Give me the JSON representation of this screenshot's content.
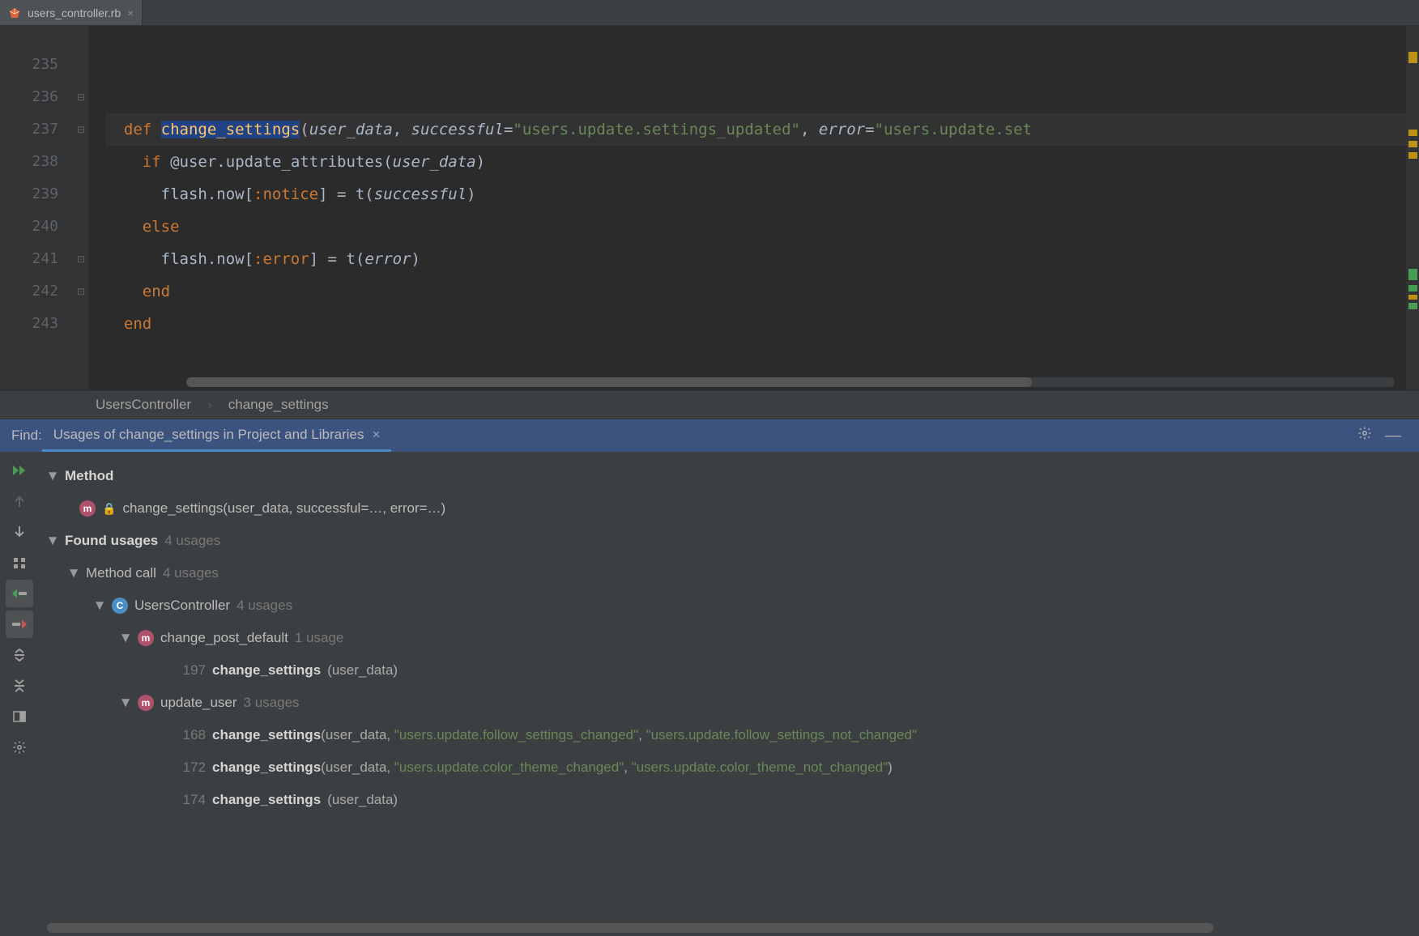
{
  "tab": {
    "filename": "users_controller.rb"
  },
  "editor": {
    "lines": [
      "235",
      "236",
      "237",
      "238",
      "239",
      "240",
      "241",
      "242",
      "243"
    ],
    "code": {
      "l236": {
        "def": "def ",
        "name": "change_settings",
        "open": "(",
        "p1": "user_data",
        "c1": ", ",
        "p2": "successful",
        "eq1": "=",
        "s1": "\"users.update.settings_updated\"",
        "c2": ", ",
        "p3": "error",
        "eq2": "=",
        "s2": "\"users.update.set"
      },
      "l237": {
        "if": "if ",
        "ivar": "@user",
        "dot": ".",
        "m": "update_attributes",
        "open": "(",
        "p": "user_data",
        "close": ")"
      },
      "l238": {
        "pre": "flash.now[",
        "sym": ":notice",
        "post": "] = t(",
        "p": "successful",
        "close": ")"
      },
      "l239": {
        "else": "else"
      },
      "l240": {
        "pre": "flash.now[",
        "sym": ":error",
        "post": "] = t(",
        "p": "error",
        "close": ")"
      },
      "l241": {
        "end": "end"
      },
      "l242": {
        "end": "end"
      }
    }
  },
  "breadcrumb": {
    "class": "UsersController",
    "method": "change_settings"
  },
  "find": {
    "label": "Find:",
    "title": "Usages of change_settings in Project and Libraries"
  },
  "tree": {
    "method_header": "Method",
    "method_sig": "change_settings(user_data, successful=…, error=…)",
    "found": "Found usages",
    "found_count": "4 usages",
    "method_call": "Method call",
    "method_call_count": "4 usages",
    "controller": "UsersController",
    "controller_count": "4 usages",
    "cpd": "change_post_default",
    "cpd_count": "1 usage",
    "uu": "update_user",
    "uu_count": "3 usages",
    "r1": {
      "ln": "197",
      "call": "change_settings",
      "args": "(user_data)"
    },
    "r2": {
      "ln": "168",
      "call": "change_settings",
      "args_pre": "(user_data, ",
      "s1": "\"users.update.follow_settings_changed\"",
      "c": ", ",
      "s2": "\"users.update.follow_settings_not_changed\""
    },
    "r3": {
      "ln": "172",
      "call": "change_settings",
      "args_pre": "(user_data, ",
      "s1": "\"users.update.color_theme_changed\"",
      "c": ", ",
      "s2": "\"users.update.color_theme_not_changed\"",
      "close": ")"
    },
    "r4": {
      "ln": "174",
      "call": "change_settings",
      "args": "(user_data)"
    }
  }
}
